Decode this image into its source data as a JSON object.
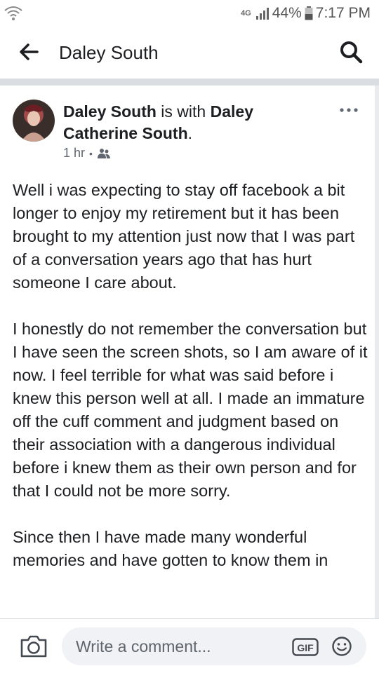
{
  "status_bar": {
    "network": "4G",
    "battery": "44%",
    "time": "7:17 PM"
  },
  "header": {
    "title": "Daley South"
  },
  "post": {
    "author": "Daley South",
    "with_text": " is with ",
    "tagged": "Daley Catherine South",
    "period": ".",
    "time": "1 hr",
    "dot": "•",
    "paragraphs": [
      "Well i was expecting to stay off facebook a bit longer to enjoy my retirement but it has been brought to my attention just now that I was part of a conversation years ago that has hurt someone I care about.",
      "I honestly do not remember the conversation but I have seen the screen shots, so I am aware of it now. I feel terrible for what was said before i knew this person well at all. I made an immature off the cuff comment and judgment based on their association with a dangerous individual before i knew them as their own person and for that I could not be more sorry.",
      "Since then I have made many wonderful memories and have gotten to know them in"
    ]
  },
  "comment_bar": {
    "placeholder": "Write a comment..."
  },
  "icons": {
    "back": "back-arrow-icon",
    "search": "search-icon",
    "more": "more-options-icon",
    "audience": "friends-icon",
    "camera": "camera-icon",
    "gif": "gif-icon",
    "emoji": "emoji-icon"
  }
}
